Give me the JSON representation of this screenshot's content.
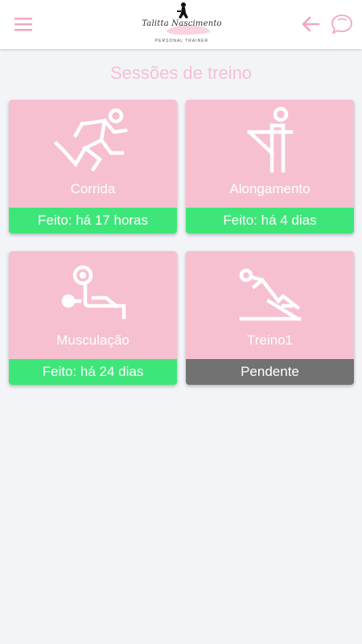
{
  "header": {
    "logo_script": "Talitta Nascimento",
    "logo_subtitle": "PERSONAL TRAINER",
    "menu_icon": "hamburger-icon",
    "back_icon": "arrow-left-icon",
    "chat_icon": "chat-bubble-icon",
    "accent_color": "#f3a5bd"
  },
  "page": {
    "title": "Sessões de treino"
  },
  "sessions": [
    {
      "label": "Corrida",
      "status": "Feito: há 17 horas",
      "state": "done",
      "icon": "running-icon"
    },
    {
      "label": "Alongamento",
      "status": "Feito: há 4 dias",
      "state": "done",
      "icon": "stretching-icon"
    },
    {
      "label": "Musculação",
      "status": "Feito: há 24 dias",
      "state": "done",
      "icon": "weightlifting-icon"
    },
    {
      "label": "Treino1",
      "status": "Pendente",
      "state": "pending",
      "icon": "situp-icon"
    }
  ],
  "colors": {
    "card_bg": "#f6c0d0",
    "done": "#3ee679",
    "pending": "#727272",
    "page_bg": "#f2f4f8"
  }
}
